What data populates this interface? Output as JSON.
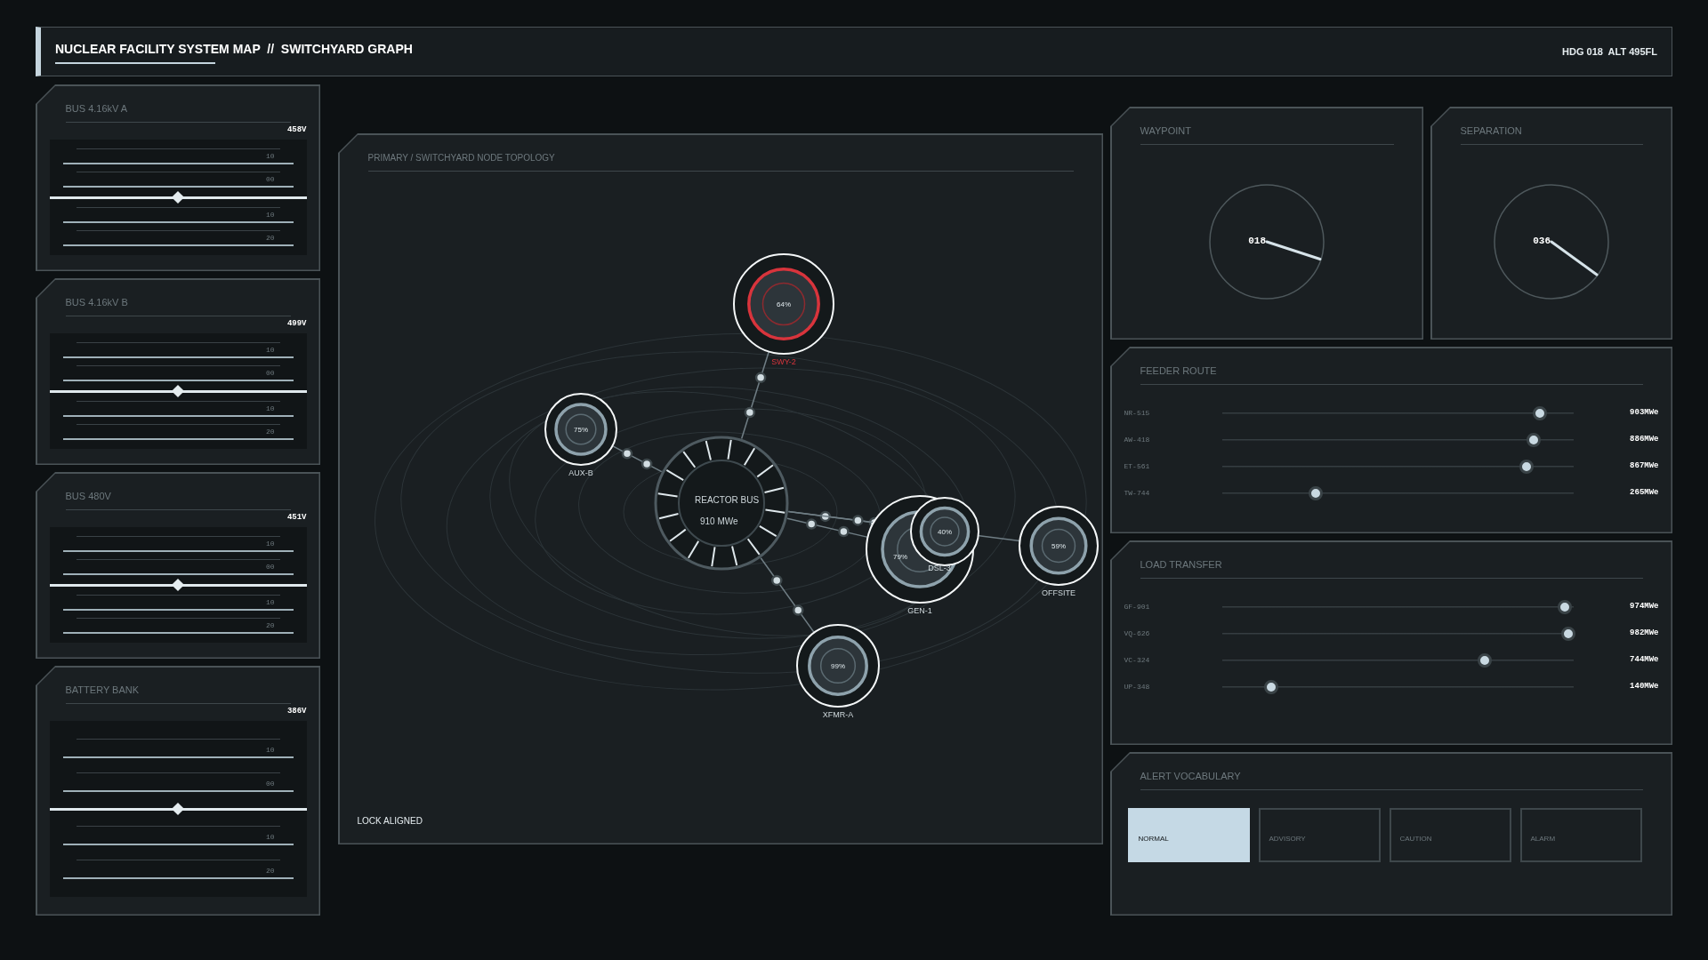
{
  "header": {
    "title": "NUCLEAR FACILITY SYSTEM MAP  //  SWITCHYARD GRAPH",
    "status": "HDG 018  ALT 495FL"
  },
  "bus_panels": [
    {
      "title": "BUS 4.16kV A",
      "reading": "458V",
      "level": 0.5,
      "ticks": [
        "10",
        "00",
        "10",
        "20"
      ]
    },
    {
      "title": "BUS 4.16kV B",
      "reading": "499V",
      "level": 0.5,
      "ticks": [
        "10",
        "00",
        "10",
        "20"
      ]
    },
    {
      "title": "BUS 480V",
      "reading": "451V",
      "level": 0.5,
      "ticks": [
        "10",
        "00",
        "10",
        "20"
      ]
    },
    {
      "title": "BATTERY BANK",
      "reading": "386V",
      "level": 0.5,
      "ticks": [
        "10",
        "00",
        "10",
        "20"
      ]
    }
  ],
  "topology": {
    "title": "PRIMARY / SWITCHYARD NODE TOPOLOGY",
    "footer": "LOCK ALIGNED",
    "hub": {
      "label": "REACTOR BUS",
      "value": "910 MWe"
    },
    "nodes": [
      {
        "label": "SWY-2",
        "value": "64%",
        "alert": true
      },
      {
        "label": "AUX-B",
        "value": "75%",
        "alert": false
      },
      {
        "label": "GEN-1",
        "value": "79%",
        "alert": false
      },
      {
        "label": "DSL-3",
        "value": "40%",
        "alert": false
      },
      {
        "label": "OFFSITE",
        "value": "59%",
        "alert": false
      },
      {
        "label": "XFMR-A",
        "value": "99%",
        "alert": false
      }
    ]
  },
  "waypoint": {
    "title": "WAYPOINT",
    "value": "018"
  },
  "separation": {
    "title": "SEPARATION",
    "value": "036"
  },
  "feeder_route": {
    "title": "FEEDER ROUTE",
    "rows": [
      {
        "name": "NR-515",
        "level": 0.905,
        "reading": "903MWe"
      },
      {
        "name": "AW-418",
        "level": 0.888,
        "reading": "886MWe"
      },
      {
        "name": "ET-561",
        "level": 0.868,
        "reading": "867MWe"
      },
      {
        "name": "TW-744",
        "level": 0.267,
        "reading": "265MWe"
      }
    ]
  },
  "load_transfer": {
    "title": "LOAD TRANSFER",
    "rows": [
      {
        "name": "GF-901",
        "level": 0.977,
        "reading": "974MWe"
      },
      {
        "name": "VQ-626",
        "level": 0.986,
        "reading": "982MWe"
      },
      {
        "name": "VC-324",
        "level": 0.747,
        "reading": "744MWe"
      },
      {
        "name": "UP-348",
        "level": 0.14,
        "reading": "140MWe"
      }
    ]
  },
  "alert_vocabulary": {
    "title": "ALERT VOCABULARY",
    "levels": [
      {
        "label": "NORMAL",
        "selected": true
      },
      {
        "label": "ADVISORY",
        "selected": false
      },
      {
        "label": "CAUTION",
        "selected": false
      },
      {
        "label": "ALARM",
        "selected": false
      }
    ]
  }
}
